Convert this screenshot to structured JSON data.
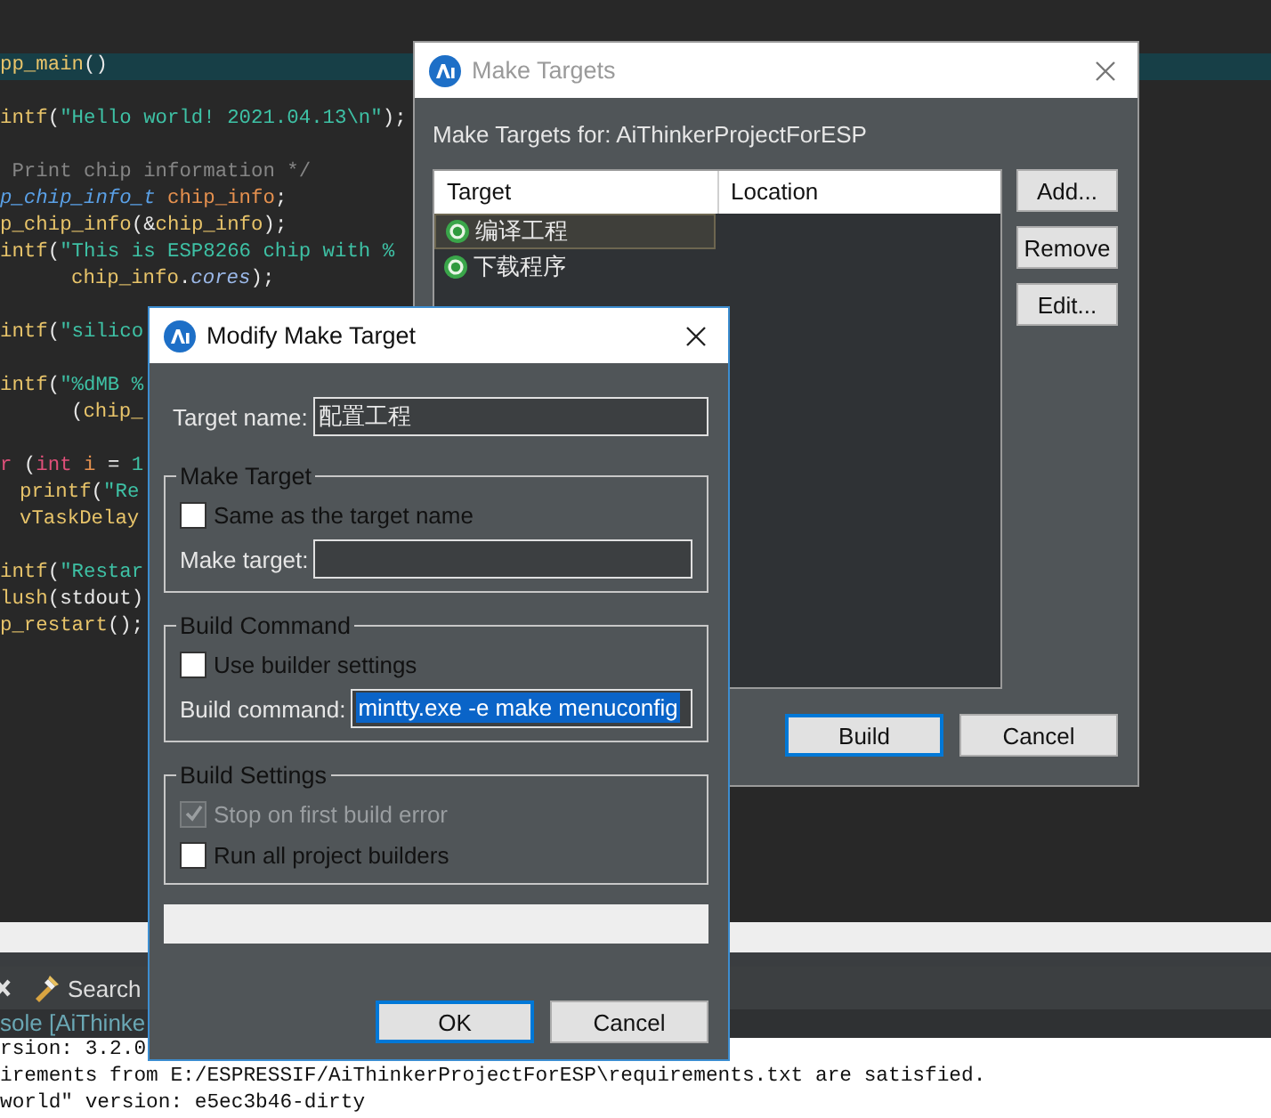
{
  "editor": {
    "lines": [
      {
        "current": true,
        "segments": [
          {
            "kind": "fn",
            "text": "pp_main"
          },
          {
            "kind": "plain",
            "text": "()"
          }
        ]
      },
      {
        "space_above": true,
        "segments": [
          {
            "kind": "fn",
            "text": "intf"
          },
          {
            "kind": "plain",
            "text": "("
          },
          {
            "kind": "str",
            "text": "\"Hello world! 2021.04.13\\n\""
          },
          {
            "kind": "plain",
            "text": ");"
          }
        ]
      },
      {
        "space_above": true,
        "segments": [
          {
            "kind": "comment",
            "text": " Print chip information */"
          }
        ]
      },
      {
        "segments": [
          {
            "kind": "type",
            "text": "p_chip_info_t "
          },
          {
            "kind": "var",
            "text": "chip_info"
          },
          {
            "kind": "plain",
            "text": ";"
          }
        ]
      },
      {
        "segments": [
          {
            "kind": "fn",
            "text": "p_chip_info"
          },
          {
            "kind": "plain",
            "text": "(&"
          },
          {
            "kind": "fn",
            "text": "chip_info"
          },
          {
            "kind": "plain",
            "text": ");"
          }
        ]
      },
      {
        "segments": [
          {
            "kind": "fn",
            "text": "intf"
          },
          {
            "kind": "plain",
            "text": "("
          },
          {
            "kind": "str",
            "text": "\"This is ESP8266 chip with %"
          }
        ]
      },
      {
        "kind": "continuation",
        "segments": [
          {
            "kind": "fn",
            "text": "chip_info"
          },
          {
            "kind": "plain",
            "text": "."
          },
          {
            "kind": "field",
            "text": "cores"
          },
          {
            "kind": "plain",
            "text": ");"
          }
        ]
      },
      {
        "space_above": true,
        "segments": [
          {
            "kind": "fn",
            "text": "intf"
          },
          {
            "kind": "plain",
            "text": "("
          },
          {
            "kind": "str",
            "text": "\"silico"
          }
        ]
      },
      {
        "space_above": true,
        "segments": [
          {
            "kind": "fn",
            "text": "intf"
          },
          {
            "kind": "plain",
            "text": "("
          },
          {
            "kind": "str",
            "text": "\"%dMB %"
          }
        ]
      },
      {
        "kind": "continuation",
        "segments": [
          {
            "kind": "plain",
            "text": "("
          },
          {
            "kind": "fn",
            "text": "chip_"
          }
        ]
      },
      {
        "space_above": true,
        "segments": [
          {
            "kind": "kw",
            "text": "r"
          },
          {
            "kind": "plain",
            "text": " ("
          },
          {
            "kind": "kw",
            "text": "int "
          },
          {
            "kind": "var",
            "text": "i"
          },
          {
            "kind": "plain",
            "text": " = "
          },
          {
            "kind": "num",
            "text": "1"
          }
        ]
      },
      {
        "kind": "nested",
        "segments": [
          {
            "kind": "fn",
            "text": "printf"
          },
          {
            "kind": "plain",
            "text": "("
          },
          {
            "kind": "str",
            "text": "\"Re"
          }
        ]
      },
      {
        "kind": "nested",
        "segments": [
          {
            "kind": "fn",
            "text": "vTaskDelay"
          }
        ]
      },
      {
        "space_above": true,
        "segments": [
          {
            "kind": "fn",
            "text": "intf"
          },
          {
            "kind": "plain",
            "text": "("
          },
          {
            "kind": "str",
            "text": "\"Restar"
          }
        ]
      },
      {
        "segments": [
          {
            "kind": "fn",
            "text": "lush"
          },
          {
            "kind": "plain",
            "text": "(stdout)"
          }
        ]
      },
      {
        "segments": [
          {
            "kind": "fn",
            "text": "p_restart"
          },
          {
            "kind": "plain",
            "text": "();"
          }
        ]
      }
    ]
  },
  "bottom_panel": {
    "tabs": [
      {
        "label": "Search",
        "selected": false
      }
    ],
    "console_title": "sole [AiThinke",
    "console_lines": [
      "rsion: 3.2.0",
      "irements from E:/ESPRESSIF/AiThinkerProjectForESP\\requirements.txt are satisfied.",
      "world\" version: e5ec3b46-dirty"
    ]
  },
  "make_targets_dialog": {
    "title": "Make Targets",
    "active": false,
    "heading": "Make Targets for: AiThinkerProjectForESP",
    "table": {
      "columns": [
        "Target",
        "Location"
      ],
      "rows": [
        {
          "target": "编译工程",
          "selected": true
        },
        {
          "target": "下载程序",
          "selected": false
        }
      ]
    },
    "side_buttons": [
      "Add...",
      "Remove",
      "Edit..."
    ],
    "buttons": [
      {
        "label": "Build",
        "default": true
      },
      {
        "label": "Cancel",
        "default": false
      }
    ]
  },
  "modify_dialog": {
    "title": "Modify Make Target",
    "active": true,
    "target_name": {
      "label": "Target name:",
      "value": "配置工程"
    },
    "groups": [
      {
        "title": "Make Target",
        "items": [
          {
            "kind": "checkbox",
            "label": "Same as the target name",
            "checked": false,
            "disabled": false
          },
          {
            "kind": "field",
            "label": "Make target:"
          }
        ]
      },
      {
        "title": "Build Command",
        "items": [
          {
            "kind": "checkbox",
            "label": "Use builder settings",
            "checked": false,
            "disabled": false
          },
          {
            "kind": "field",
            "label": "Build command:",
            "value": "mintty.exe -e make menuconfig",
            "selected": true
          }
        ]
      },
      {
        "title": "Build Settings",
        "items": [
          {
            "kind": "checkbox",
            "label": "Stop on first build error",
            "checked": true,
            "disabled": true
          },
          {
            "kind": "checkbox",
            "label": "Run all project builders",
            "checked": false,
            "disabled": false
          }
        ]
      }
    ],
    "buttons": [
      {
        "label": "OK",
        "default": true
      },
      {
        "label": "Cancel",
        "default": false
      }
    ]
  }
}
